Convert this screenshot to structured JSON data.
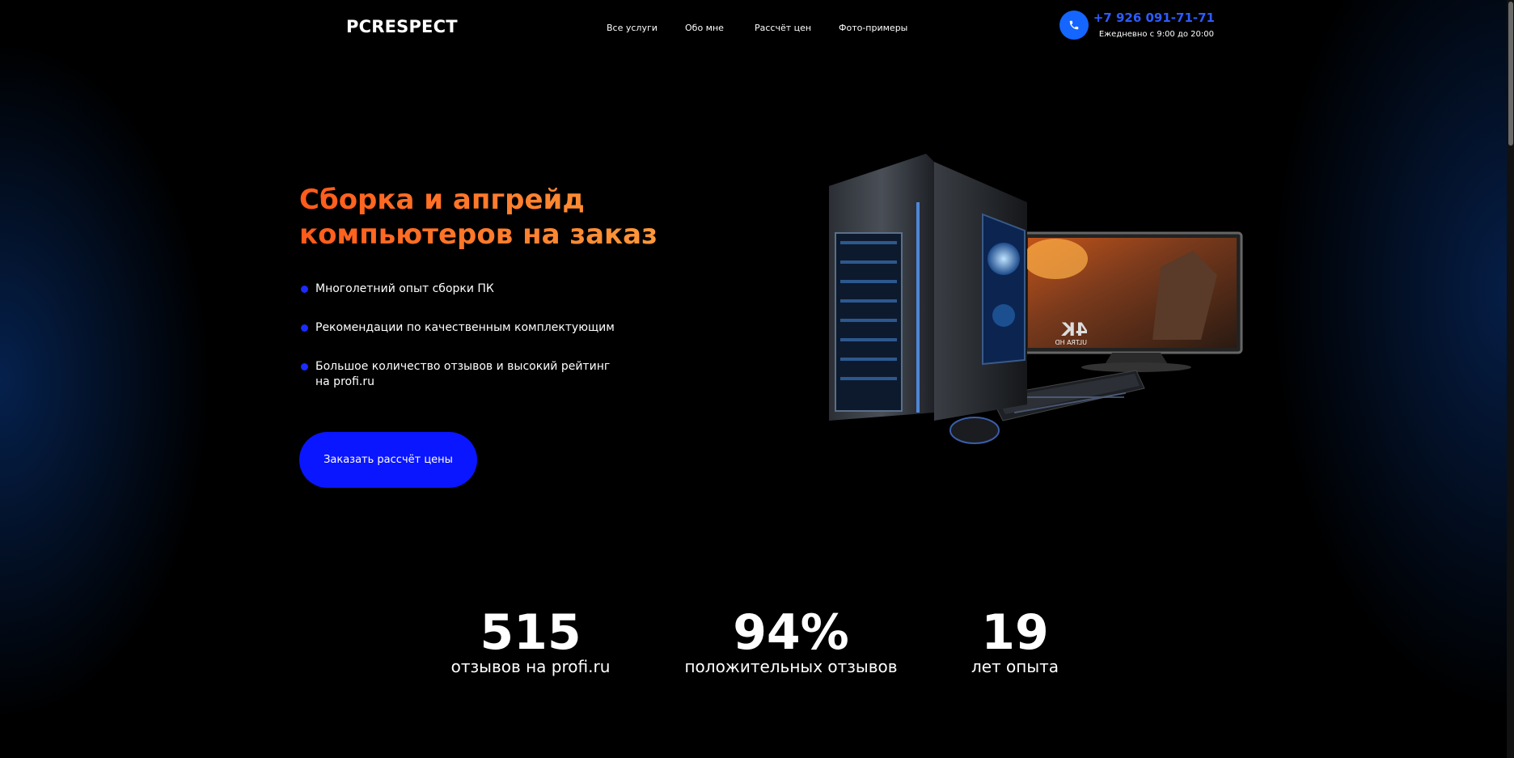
{
  "header": {
    "logo": "PCRESPECT",
    "nav": [
      {
        "label": "Все услуги"
      },
      {
        "label": "Обо мне"
      },
      {
        "label": "Рассчёт цен"
      },
      {
        "label": "Фото-примеры"
      }
    ],
    "phone_number": "+7 926 091-71-71",
    "hours": "Ежедневно с 9:00 до 20:00"
  },
  "hero": {
    "title_line1": "Сборка и апгрейд",
    "title_line2": "компьютеров на заказ",
    "features": [
      "Многолетний опыт сборки ПК",
      "Рекомендации по качественным комплектующим",
      "Большое количество отзывов и высокий рейтинг на profi.ru"
    ],
    "cta_label": "Заказать рассчёт цены",
    "monitor_badge": "ULTRA HD",
    "monitor_badge_big": "4K"
  },
  "stats": [
    {
      "value": "515",
      "label": "отзывов на profi.ru"
    },
    {
      "value": "94%",
      "label": "положительных отзывов"
    },
    {
      "value": "19",
      "label": "лет опыта"
    }
  ],
  "colors": {
    "accent_blue": "#0a16ff",
    "phone_blue": "#1565ff",
    "title_gradient_start": "#ff5a1a",
    "title_gradient_end": "#ffa340"
  }
}
